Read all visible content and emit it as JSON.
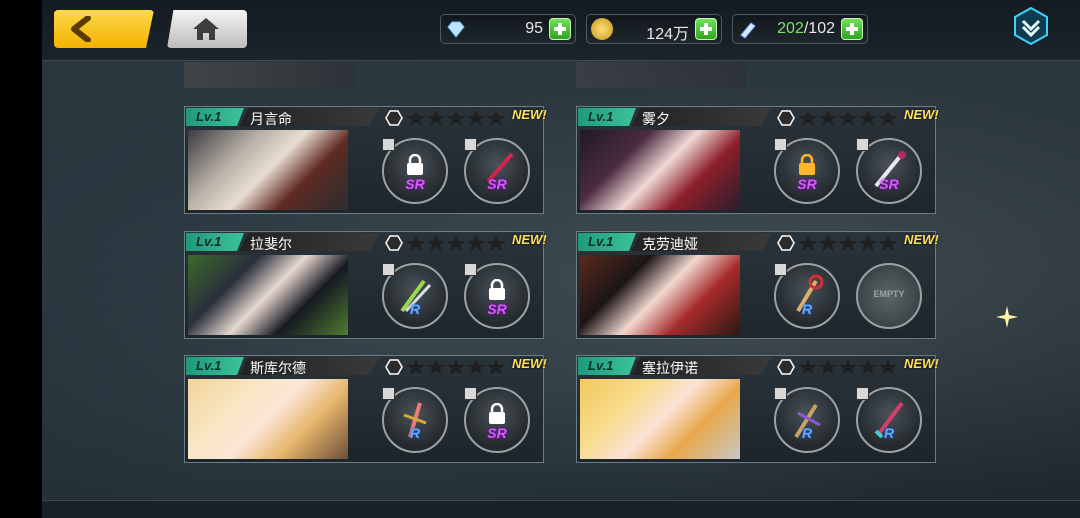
{
  "header": {
    "diamonds": "95",
    "gold": "124万",
    "stamina_current": "202",
    "stamina_separator": "/",
    "stamina_max": "102"
  },
  "colors": {
    "accent_yellow": "#f2b200",
    "level_green": "#3cc39b",
    "sr_purple": "#d65bff",
    "r_blue": "#66a7ff"
  },
  "cards": [
    {
      "level": "Lv.1",
      "name": "月言命",
      "new": "NEW!",
      "slot1_rank": "SR",
      "slot2_rank": "SR"
    },
    {
      "level": "Lv.1",
      "name": "雾夕",
      "new": "NEW!",
      "slot1_rank": "SR",
      "slot2_rank": "SR"
    },
    {
      "level": "Lv.1",
      "name": "拉斐尔",
      "new": "NEW!",
      "slot1_rank": "R",
      "slot2_rank": "SR"
    },
    {
      "level": "Lv.1",
      "name": "克劳迪娅",
      "new": "NEW!",
      "slot1_rank": "R",
      "slot2_empty": "EMPTY"
    },
    {
      "level": "Lv.1",
      "name": "斯库尔德",
      "new": "NEW!",
      "slot1_rank": "R",
      "slot2_rank": "SR"
    },
    {
      "level": "Lv.1",
      "name": "塞拉伊诺",
      "new": "NEW!",
      "slot1_rank": "R",
      "slot2_rank": "R"
    }
  ]
}
